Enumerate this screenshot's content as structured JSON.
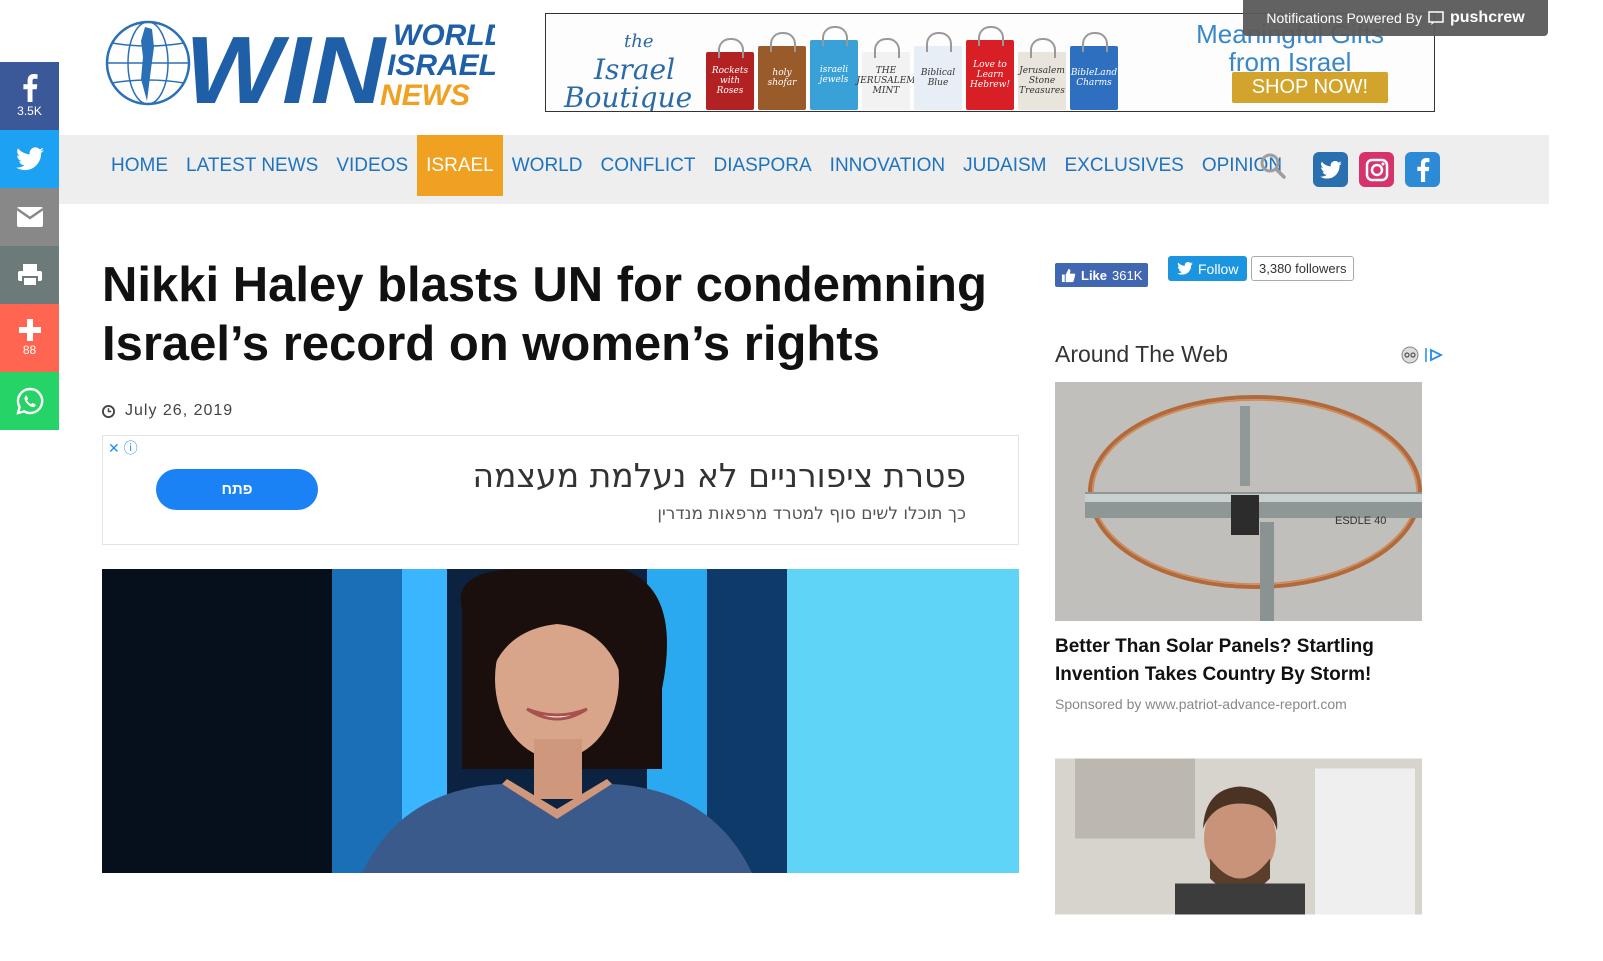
{
  "share": {
    "facebook_count": "3.5K",
    "plus_count": "88"
  },
  "logo": {
    "win": "WIN",
    "line1": "WORLD",
    "line2": "ISRAEL",
    "line3": "NEWS"
  },
  "banner": {
    "brand_the": "the",
    "brand_line1": "Israel",
    "brand_line2": "Boutique",
    "tagline_1": "Meaningful Gifts",
    "tagline_2": "from Israel",
    "shop_label": "SHOP NOW!",
    "bags": [
      {
        "label": "Rockets with Roses",
        "color": "#b32222"
      },
      {
        "label": "holy shofar",
        "color": "#9a5b2a"
      },
      {
        "label": "israeli jewels",
        "color": "#3aa0d8"
      },
      {
        "label": "THE JERUSALEM MINT",
        "color": "#f2f2f2"
      },
      {
        "label": "Biblical Blue",
        "color": "#e8eef5"
      },
      {
        "label": "Love to Learn Hebrew!",
        "color": "#d81f26"
      },
      {
        "label": "Jerusalem Stone Treasures",
        "color": "#e9e4dc"
      },
      {
        "label": "BibleLand Charms",
        "color": "#2f6fc0"
      }
    ]
  },
  "pushcrew": {
    "text": "Notifications Powered By",
    "brand": "pushcrew"
  },
  "nav": {
    "items": [
      {
        "label": "HOME",
        "active": false
      },
      {
        "label": "LATEST NEWS",
        "active": false
      },
      {
        "label": "VIDEOS",
        "active": false
      },
      {
        "label": "ISRAEL",
        "active": true
      },
      {
        "label": "WORLD",
        "active": false
      },
      {
        "label": "CONFLICT",
        "active": false
      },
      {
        "label": "DIASPORA",
        "active": false
      },
      {
        "label": "INNOVATION",
        "active": false
      },
      {
        "label": "JUDAISM",
        "active": false
      },
      {
        "label": "EXCLUSIVES",
        "active": false
      },
      {
        "label": "OPINION",
        "active": false
      }
    ]
  },
  "article": {
    "title": "Nikki Haley blasts UN for condemning Israel’s record on women’s rights",
    "date": "July 26, 2019"
  },
  "ad": {
    "headline": "פטרת ציפורניים לא נעלמת מעצמה",
    "subline": "כך תוכלו לשים סוף למטרד מרפאות מנדרין",
    "button": "פתח"
  },
  "sidebar": {
    "fb_like": "Like",
    "fb_like_count": "361K",
    "tw_follow": "Follow",
    "tw_followers": "3,380 followers",
    "around_title": "Around The Web",
    "cards": [
      {
        "headline": "Better Than Solar Panels? Startling Invention Takes Country By Storm!",
        "sponsor": "Sponsored by www.patriot-advance-report.com"
      }
    ]
  },
  "colors": {
    "nav_link": "#1e73be",
    "nav_active": "#f0a122",
    "facebook": "#3b5998",
    "twitter": "#1da1f2",
    "whatsapp": "#25d366",
    "plus": "#ff6550"
  }
}
